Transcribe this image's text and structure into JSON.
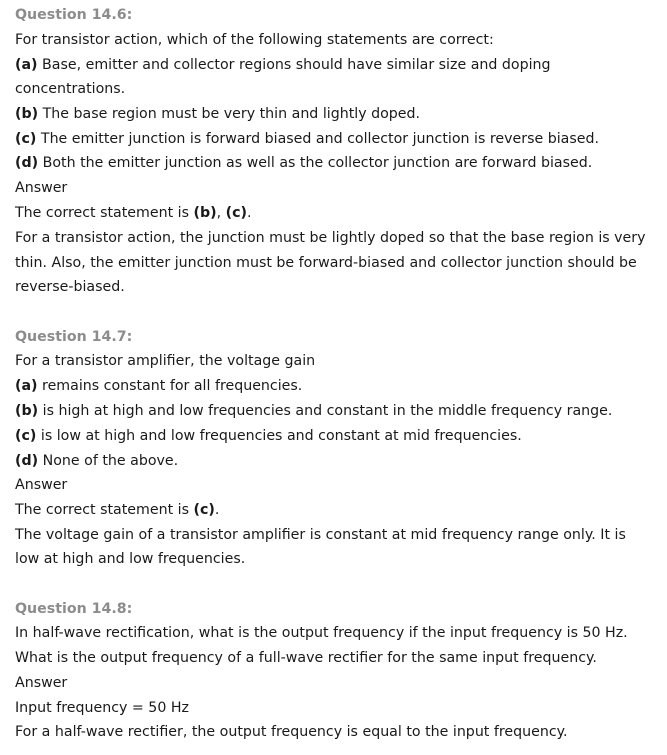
{
  "questions": [
    {
      "heading": "Question 14.6:",
      "lines": [
        "For transistor action, which of the following statements are correct:"
      ],
      "options": [
        {
          "label": "(a)",
          "text": " Base, emitter and collector regions should have similar size and doping",
          "text2": "concentrations."
        },
        {
          "label": "(b)",
          "text": " The base region must be very thin and lightly doped."
        },
        {
          "label": "(c)",
          "text": " The emitter junction is forward biased and collector junction is reverse biased."
        },
        {
          "label": "(d)",
          "text": " Both the emitter junction as well as the collector junction are forward biased."
        }
      ],
      "answer_label": "Answer",
      "correct_prefix": "The correct statement is ",
      "correct_value": "(b)",
      "correct_sep": ", ",
      "correct_value2": "(c)",
      "correct_suffix": ".",
      "explanation": [
        "For a transistor action, the junction must be lightly doped so that the base region is very",
        "thin. Also, the emitter junction must be forward-biased and collector junction should be",
        "reverse-biased."
      ]
    },
    {
      "heading": "Question 14.7:",
      "lines": [
        "For a transistor amplifier, the voltage gain"
      ],
      "options": [
        {
          "label": "(a)",
          "text": " remains constant for all frequencies."
        },
        {
          "label": "(b)",
          "text": " is high at high and low frequencies and constant in the middle frequency range."
        },
        {
          "label": "(c)",
          "text": " is low at high and low frequencies and constant at mid frequencies."
        },
        {
          "label": "(d)",
          "text": " None of the above."
        }
      ],
      "answer_label": "Answer",
      "correct_prefix": "The correct statement is ",
      "correct_value": "(c)",
      "correct_suffix": ".",
      "explanation": [
        "The voltage gain of a transistor amplifier is constant at mid frequency range only. It is",
        "low at high and low frequencies."
      ]
    },
    {
      "heading": "Question 14.8:",
      "lines": [
        "In half-wave rectification, what is the output frequency if the input frequency is 50 Hz.",
        "What is the output frequency of a full-wave rectifier for the same input frequency."
      ],
      "answer_label": "Answer",
      "explanation": [
        "Input frequency = 50 Hz",
        "For a half-wave rectifier, the output frequency is equal to the input frequency."
      ]
    }
  ]
}
